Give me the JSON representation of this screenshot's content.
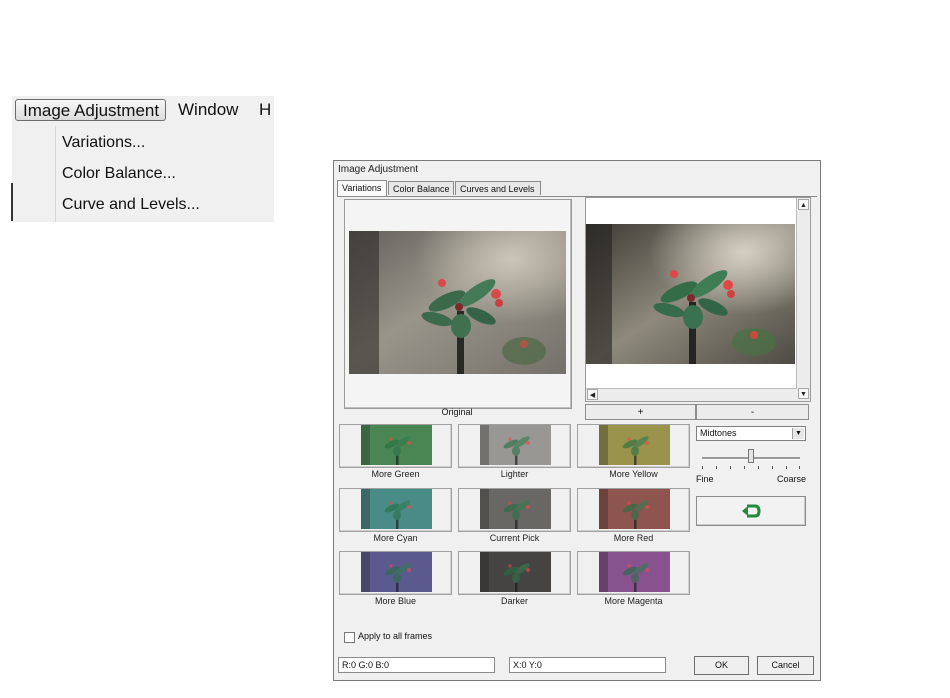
{
  "menubar": {
    "items": [
      "Image Adjustment",
      "Window",
      "H"
    ],
    "dropdown": [
      "Variations...",
      "Color Balance...",
      "Curve and Levels..."
    ]
  },
  "dialog": {
    "title": "Image Adjustment",
    "tabs": [
      "Variations",
      "Color Balance",
      "Curves and Levels"
    ],
    "active_tab": "Variations",
    "original_label": "Original",
    "plus_label": "+",
    "minus_label": "-",
    "variations": [
      {
        "label": "More Green",
        "tint": "#3f9f55"
      },
      {
        "label": "Lighter",
        "tint": "#b8b8b8"
      },
      {
        "label": "More Yellow",
        "tint": "#b9b24a"
      },
      {
        "label": "More Cyan",
        "tint": "#3fa8a4"
      },
      {
        "label": "Current Pick",
        "tint": "#707070"
      },
      {
        "label": "More Red",
        "tint": "#a9554f"
      },
      {
        "label": "More Blue",
        "tint": "#5a5cae"
      },
      {
        "label": "Darker",
        "tint": "#3b3b3b"
      },
      {
        "label": "More Magenta",
        "tint": "#a050b0"
      }
    ],
    "tone_select": "Midtones",
    "fine_label": "Fine",
    "coarse_label": "Coarse",
    "slider_value": 0.5,
    "undo_icon": "undo-arrow-icon",
    "apply_all_label": "Apply to all frames",
    "apply_all_checked": false,
    "rgb_readout": "R:0 G:0 B:0",
    "xy_readout": "X:0 Y:0",
    "ok_label": "OK",
    "cancel_label": "Cancel"
  }
}
